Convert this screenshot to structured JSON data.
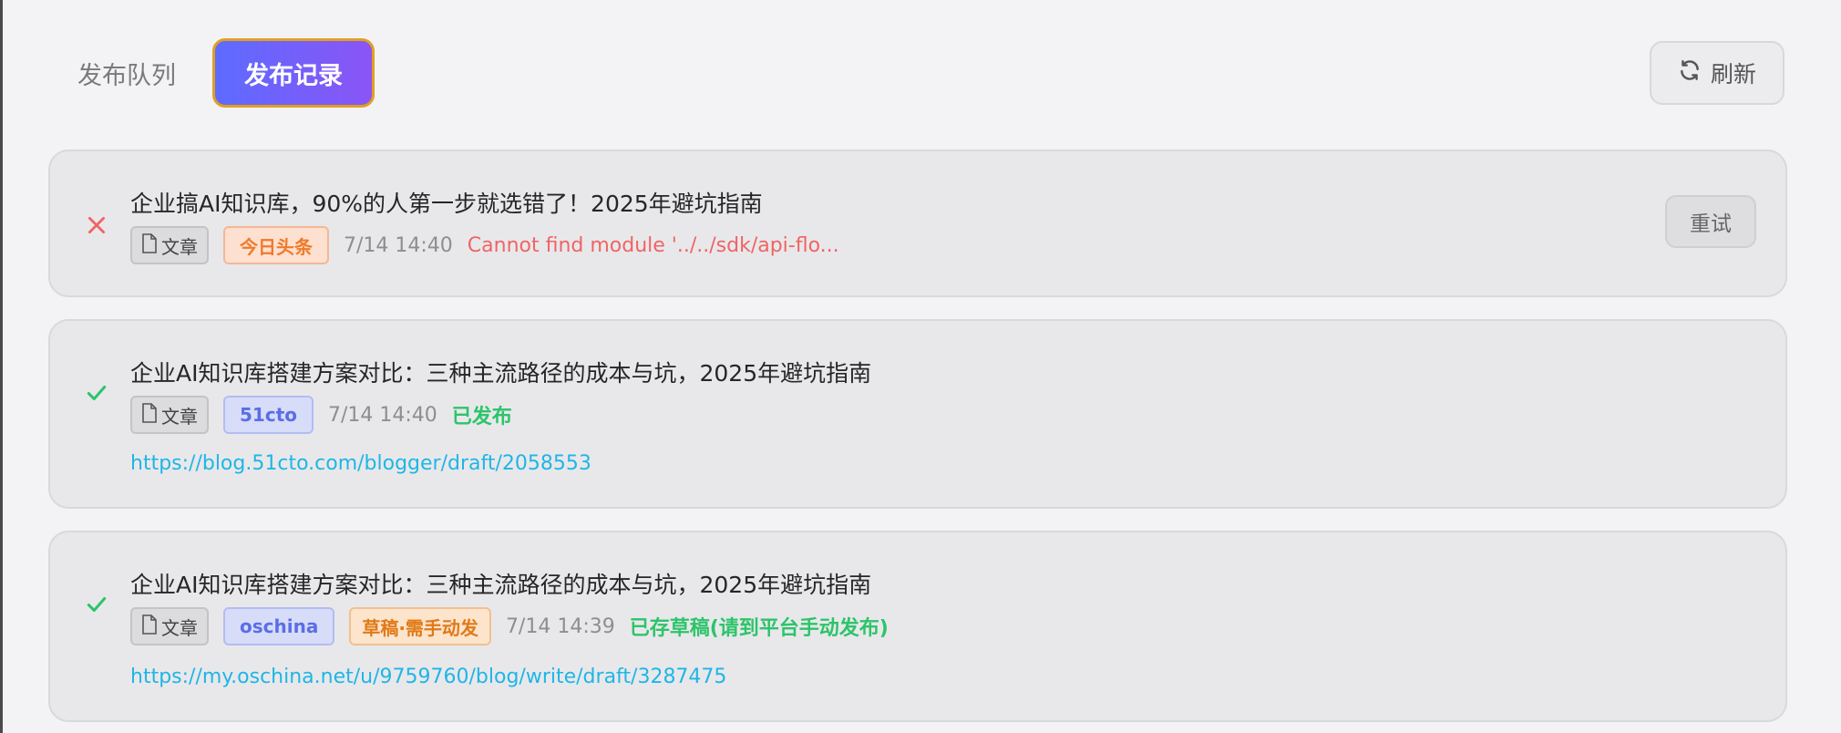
{
  "tabs": {
    "queue_label": "发布队列",
    "records_label": "发布记录"
  },
  "toolbar": {
    "refresh_label": "刷新"
  },
  "records": [
    {
      "status": "failed",
      "title": "企业搞AI知识库，90%的人第一步就选错了！2025年避坑指南",
      "type_label": "文章",
      "platform": "今日头条",
      "time": "7/14 14:40",
      "message": "Cannot find module '../../sdk/api-flo...",
      "action_label": "重试"
    },
    {
      "status": "success",
      "title": "企业AI知识库搭建方案对比：三种主流路径的成本与坑，2025年避坑指南",
      "type_label": "文章",
      "platform": "51cto",
      "time": "7/14 14:40",
      "message": "已发布",
      "url": "https://blog.51cto.com/blogger/draft/2058553"
    },
    {
      "status": "success",
      "title": "企业AI知识库搭建方案对比：三种主流路径的成本与坑，2025年避坑指南",
      "type_label": "文章",
      "platform": "oschina",
      "extra_tag": "草稿·需手动发",
      "time": "7/14 14:39",
      "message": "已存草稿(请到平台手动发布)",
      "url": "https://my.oschina.net/u/9759760/blog/write/draft/3287475"
    }
  ],
  "colors": {
    "accent_gradient_start": "#5d6bff",
    "accent_gradient_end": "#8a55f5",
    "error": "#f06464",
    "success": "#2dc46a",
    "link": "#1fb6e6"
  },
  "icons": {
    "refresh": "refresh-icon",
    "failed": "close-icon",
    "success": "check-icon",
    "document": "document-icon"
  }
}
